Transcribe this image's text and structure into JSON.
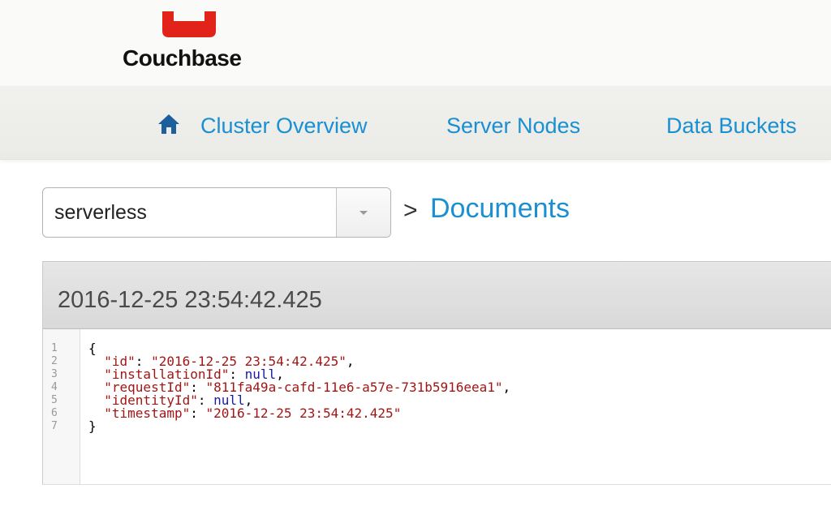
{
  "app": {
    "logo_text": "Couchbase",
    "brand_color": "#e2231a",
    "accent_color": "#1a8fd1"
  },
  "nav": {
    "items": [
      {
        "label": "Cluster Overview",
        "icon": "home-icon"
      },
      {
        "label": "Server Nodes"
      },
      {
        "label": "Data Buckets"
      }
    ]
  },
  "bucket_select": {
    "value": "serverless",
    "icon": "chevron-down-icon"
  },
  "breadcrumb": {
    "separator": ">",
    "current": "Documents"
  },
  "document": {
    "title": "2016-12-25 23:54:42.425",
    "line_numbers": [
      "1",
      "2",
      "3",
      "4",
      "5",
      "6",
      "7"
    ],
    "json": {
      "open": "{",
      "close": "}",
      "fields": [
        {
          "key": "\"id\"",
          "value": "\"2016-12-25 23:54:42.425\"",
          "type": "string",
          "comma": ","
        },
        {
          "key": "\"installationId\"",
          "value": "null",
          "type": "null",
          "comma": ","
        },
        {
          "key": "\"requestId\"",
          "value": "\"811fa49a-cafd-11e6-a57e-731b5916eea1\"",
          "type": "string",
          "comma": ","
        },
        {
          "key": "\"identityId\"",
          "value": "null",
          "type": "null",
          "comma": ","
        },
        {
          "key": "\"timestamp\"",
          "value": "\"2016-12-25 23:54:42.425\"",
          "type": "string",
          "comma": ""
        }
      ]
    }
  }
}
